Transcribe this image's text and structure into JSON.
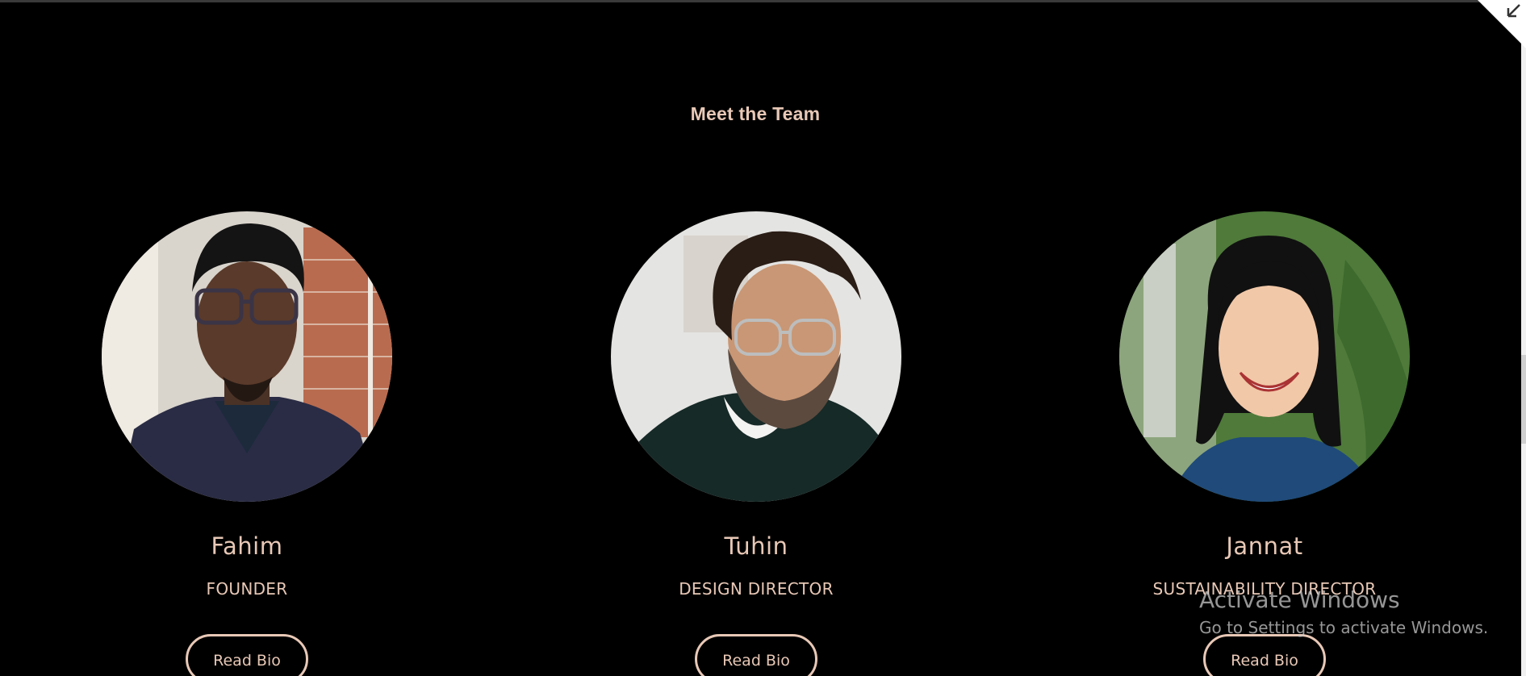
{
  "section": {
    "title": "Meet the Team"
  },
  "members": [
    {
      "name": "Fahim",
      "role": "FOUNDER",
      "button": "Read Bio"
    },
    {
      "name": "Tuhin",
      "role": "DESIGN DIRECTOR",
      "button": "Read Bio"
    },
    {
      "name": "Jannat",
      "role": "SUSTAINABILITY DIRECTOR",
      "button": "Read Bio"
    }
  ],
  "watermark": {
    "title": "Activate Windows",
    "subtitle": "Go to Settings to activate Windows."
  },
  "colors": {
    "background": "#000000",
    "accent": "#e8c8b6"
  },
  "icons": {
    "corner": "collapse-arrow-icon"
  }
}
